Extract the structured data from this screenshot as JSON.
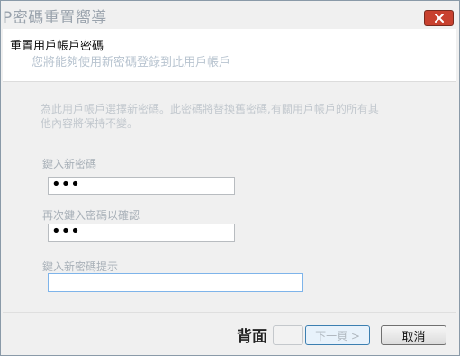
{
  "window": {
    "title": "P密碼重置嚮導",
    "close_icon": "close-icon"
  },
  "header": {
    "title": "重置用戶帳戶密碼",
    "subtitle": "您將能夠使用新密碼登錄到此用戶帳戶"
  },
  "body": {
    "description": "為此用戶帳戶選擇新密碼。此密碼將替換舊密碼,有關用戶帳戶的所有其他內容將保持不變。",
    "new_password": {
      "label": "鍵入新密碼",
      "value": "•••"
    },
    "confirm_password": {
      "label": "再次鍵入密碼以確認",
      "value": "•••"
    },
    "hint": {
      "label": "鍵入新密碼提示",
      "value": ""
    }
  },
  "footer": {
    "back_label": "背面",
    "next_label": "下一頁 >",
    "cancel_label": "取消"
  }
}
